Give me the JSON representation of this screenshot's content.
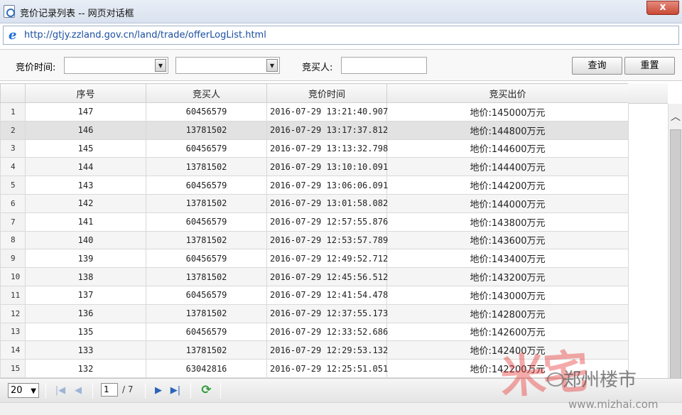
{
  "window": {
    "title": "竞价记录列表 -- 网页对话框",
    "close_label": "x",
    "url": "http://gtjy.zzland.gov.cn/land/trade/offerLogList.html"
  },
  "filters": {
    "time_label": "竞价时间:",
    "buyer_label": "竞买人:",
    "time_from_value": "",
    "time_to_value": "",
    "buyer_value": "",
    "query_button": "查询",
    "reset_button": "重置"
  },
  "grid": {
    "columns": [
      "",
      "序号",
      "竞买人",
      "竞价时间",
      "竞买出价"
    ],
    "rows": [
      {
        "idx": "1",
        "seq": "147",
        "buyer": "60456579",
        "time": "2016-07-29 13:21:40.907",
        "price": "地价:145000万元"
      },
      {
        "idx": "2",
        "seq": "146",
        "buyer": "13781502",
        "time": "2016-07-29 13:17:37.812",
        "price": "地价:144800万元"
      },
      {
        "idx": "3",
        "seq": "145",
        "buyer": "60456579",
        "time": "2016-07-29 13:13:32.798",
        "price": "地价:144600万元"
      },
      {
        "idx": "4",
        "seq": "144",
        "buyer": "13781502",
        "time": "2016-07-29 13:10:10.091",
        "price": "地价:144400万元"
      },
      {
        "idx": "5",
        "seq": "143",
        "buyer": "60456579",
        "time": "2016-07-29 13:06:06.091",
        "price": "地价:144200万元"
      },
      {
        "idx": "6",
        "seq": "142",
        "buyer": "13781502",
        "time": "2016-07-29 13:01:58.082",
        "price": "地价:144000万元"
      },
      {
        "idx": "7",
        "seq": "141",
        "buyer": "60456579",
        "time": "2016-07-29 12:57:55.876",
        "price": "地价:143800万元"
      },
      {
        "idx": "8",
        "seq": "140",
        "buyer": "13781502",
        "time": "2016-07-29 12:53:57.789",
        "price": "地价:143600万元"
      },
      {
        "idx": "9",
        "seq": "139",
        "buyer": "60456579",
        "time": "2016-07-29 12:49:52.712",
        "price": "地价:143400万元"
      },
      {
        "idx": "10",
        "seq": "138",
        "buyer": "13781502",
        "time": "2016-07-29 12:45:56.512",
        "price": "地价:143200万元"
      },
      {
        "idx": "11",
        "seq": "137",
        "buyer": "60456579",
        "time": "2016-07-29 12:41:54.478",
        "price": "地价:143000万元"
      },
      {
        "idx": "12",
        "seq": "136",
        "buyer": "13781502",
        "time": "2016-07-29 12:37:55.173",
        "price": "地价:142800万元"
      },
      {
        "idx": "13",
        "seq": "135",
        "buyer": "60456579",
        "time": "2016-07-29 12:33:52.686",
        "price": "地价:142600万元"
      },
      {
        "idx": "14",
        "seq": "133",
        "buyer": "13781502",
        "time": "2016-07-29 12:29:53.132",
        "price": "地价:142400万元"
      },
      {
        "idx": "15",
        "seq": "132",
        "buyer": "63042816",
        "time": "2016-07-29 12:25:51.051",
        "price": "地价:142200万元"
      }
    ]
  },
  "pager": {
    "page_size": "20",
    "current_page": "1",
    "total_pages": "/ 7"
  },
  "watermark": {
    "brand": "米宅",
    "channel": "郑州楼市",
    "url": "www.mizhai.com"
  },
  "icons": {
    "page": "page-icon",
    "ie": "ie-icon",
    "first": "first-page-icon",
    "prev": "prev-page-icon",
    "next": "next-page-icon",
    "last": "last-page-icon",
    "refresh": "refresh-icon"
  }
}
